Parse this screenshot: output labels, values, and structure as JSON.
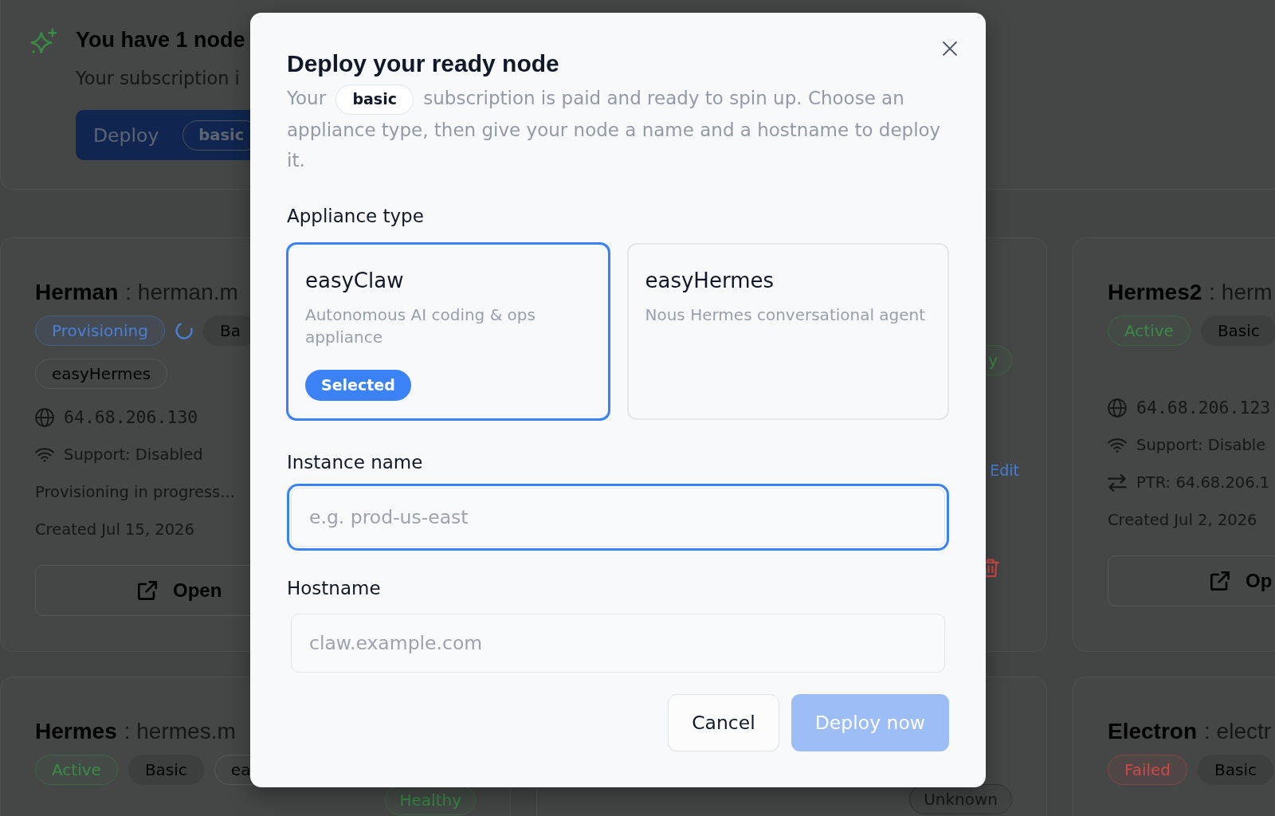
{
  "notice": {
    "title": "You have 1 node",
    "text": "Your subscription i",
    "deploy_button": {
      "label": "Deploy",
      "plan": "basic"
    }
  },
  "nodes": [
    {
      "kind": "full",
      "name": "Herman",
      "host": ": herman.m",
      "badge_lines": [
        [
          {
            "kind": "status",
            "label": "Provisioning",
            "color": "#4a7fd6"
          },
          {
            "kind": "spinner"
          },
          {
            "kind": "plan",
            "label": "Ba"
          }
        ],
        [
          {
            "kind": "appliance",
            "label": "easyHermes"
          }
        ]
      ],
      "details": [
        {
          "kind": "address",
          "text": "64.68.206.130"
        },
        {
          "kind": "support",
          "text": "Support: Disabled"
        },
        {
          "kind": "note",
          "text": "Provisioning in progress..."
        },
        {
          "kind": "created",
          "text": "Created Jul 15, 2026"
        }
      ],
      "open_button": "Open"
    },
    {
      "kind": "edge",
      "health": {
        "label": "y",
        "color": "#3a8a48"
      },
      "link": "Edit",
      "delete": true
    },
    {
      "kind": "full",
      "name": "Hermes2",
      "host": ": herm",
      "badge_lines": [
        [
          {
            "kind": "status",
            "label": "Active",
            "color": "#3a8a48"
          },
          {
            "kind": "plan",
            "label": "Basic"
          }
        ]
      ],
      "details": [
        {
          "kind": "address",
          "text": "64.68.206.123"
        },
        {
          "kind": "support",
          "text": "Support: Disable"
        },
        {
          "kind": "ptr",
          "text": "PTR: 64.68.206.1"
        },
        {
          "kind": "created",
          "text": "Created Jul 2, 2026"
        }
      ],
      "open_button": "Op"
    },
    {
      "kind": "full",
      "name": "Hermes",
      "host": ": hermes.m",
      "badge_lines": [
        [
          {
            "kind": "status",
            "label": "Active",
            "color": "#3a8a48"
          },
          {
            "kind": "plan",
            "label": "Basic"
          },
          {
            "kind": "appliance",
            "label": "ea"
          }
        ]
      ],
      "health": {
        "label": "Healthy",
        "color": "#3a8a48"
      }
    },
    {
      "kind": "edge",
      "health": {
        "label": "Unknown",
        "color": "#151616"
      }
    },
    {
      "kind": "full",
      "name": "Electron",
      "host": ": electr",
      "badge_lines": [
        [
          {
            "kind": "status",
            "label": "Failed",
            "color": "#d04848"
          },
          {
            "kind": "plan",
            "label": "Basic"
          }
        ]
      ]
    }
  ],
  "dialog": {
    "title": "Deploy your ready node",
    "description": {
      "before": "Your",
      "plan": "basic",
      "after": "subscription is paid and ready to spin up. Choose an appliance type, then give your node a name and a hostname to deploy it."
    },
    "appliance_label": "Appliance type",
    "appliances": [
      {
        "name": "easyClaw",
        "description": "Autonomous AI coding & ops appliance",
        "selected": true,
        "badge": "Selected"
      },
      {
        "name": "easyHermes",
        "description": "Nous Hermes conversational agent",
        "selected": false
      }
    ],
    "fields": [
      {
        "label": "Instance name",
        "placeholder": "e.g. prod-us-east",
        "focused": true
      },
      {
        "label": "Hostname",
        "placeholder": "claw.example.com",
        "focused": false
      }
    ],
    "buttons": [
      {
        "label": "Cancel",
        "kind": "secondary",
        "disabled": false
      },
      {
        "label": "Deploy now",
        "kind": "primary",
        "disabled": true
      }
    ]
  }
}
